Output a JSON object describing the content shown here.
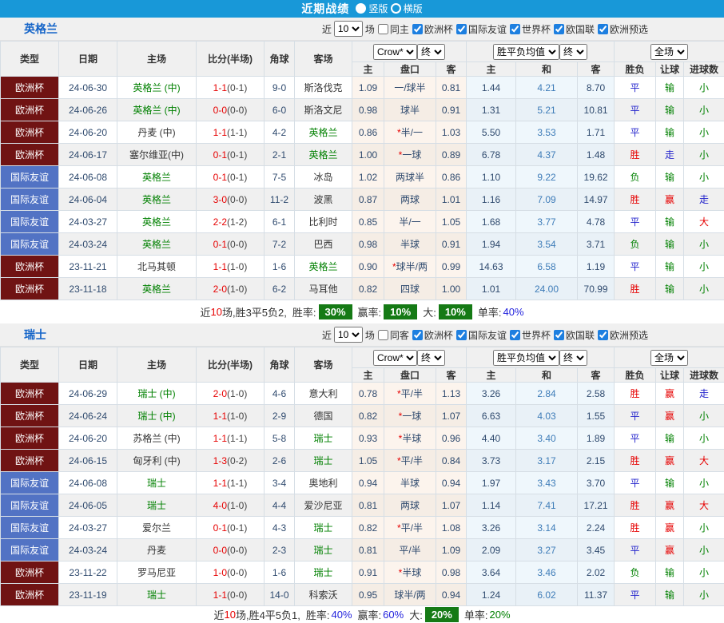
{
  "title_bar": {
    "title": "近期战绩",
    "layout_options": [
      {
        "label": "竖版",
        "selected": true
      },
      {
        "label": "横版",
        "selected": false
      }
    ]
  },
  "colors": {
    "titlebar_bg": "#1898d8",
    "team_link_green": "#008000",
    "section_title_blue": "#1464c8",
    "score_red": "#e60000",
    "badge_green_bg": "#157a15",
    "type_colors": {
      "欧洲杯": "#701313",
      "国际友谊": "#5273c4"
    },
    "result_colors": {
      "胜": "#e60000",
      "平": "#2323cc",
      "负": "#008000",
      "赢": "#e60000",
      "输": "#008000",
      "走": "#2323cc",
      "大": "#e60000",
      "小": "#008000"
    }
  },
  "table_header": {
    "type": "类型",
    "date": "日期",
    "home": "主场",
    "score": "比分(半场)",
    "corner": "角球",
    "away": "客场",
    "odds_company_select": "Crow*",
    "odds_final_select": "终",
    "odds_cols": [
      "主",
      "盘口",
      "客"
    ],
    "mean_select": "胜平负均值",
    "mean_final_select": "终",
    "mean_cols": [
      "主",
      "和",
      "客"
    ],
    "scope_select": "全场",
    "result_cols": [
      "胜负",
      "让球",
      "进球数"
    ]
  },
  "sections": [
    {
      "team": "英格兰",
      "filter": {
        "near_label": "近",
        "count_value": "10",
        "games_label": "场",
        "same_label": "同主",
        "same_checked": false,
        "leagues": [
          {
            "label": "欧洲杯",
            "checked": true
          },
          {
            "label": "国际友谊",
            "checked": true
          },
          {
            "label": "世界杯",
            "checked": true
          },
          {
            "label": "欧国联",
            "checked": true
          },
          {
            "label": "欧洲预选",
            "checked": true
          }
        ]
      },
      "rows": [
        {
          "type": "欧洲杯",
          "date": "24-06-30",
          "home": "英格兰 (中)",
          "home_is_team": true,
          "score": "1-1",
          "half": "(0-1)",
          "corner": "9-0",
          "away": "斯洛伐克",
          "away_is_team": false,
          "crow_home": "1.09",
          "handicap": "一/球半",
          "crow_away": "0.81",
          "mean_home": "1.44",
          "mean_draw": "4.21",
          "mean_away": "8.70",
          "result": "平",
          "handicap_result": "输",
          "goals_result": "小"
        },
        {
          "type": "欧洲杯",
          "date": "24-06-26",
          "home": "英格兰 (中)",
          "home_is_team": true,
          "score": "0-0",
          "half": "(0-0)",
          "corner": "6-0",
          "away": "斯洛文尼",
          "away_is_team": false,
          "crow_home": "0.98",
          "handicap": "球半",
          "crow_away": "0.91",
          "mean_home": "1.31",
          "mean_draw": "5.21",
          "mean_away": "10.81",
          "result": "平",
          "handicap_result": "输",
          "goals_result": "小"
        },
        {
          "type": "欧洲杯",
          "date": "24-06-20",
          "home": "丹麦 (中)",
          "home_is_team": false,
          "score": "1-1",
          "half": "(1-1)",
          "corner": "4-2",
          "away": "英格兰",
          "away_is_team": true,
          "crow_home": "0.86",
          "handicap": "*半/一",
          "crow_away": "1.03",
          "mean_home": "5.50",
          "mean_draw": "3.53",
          "mean_away": "1.71",
          "result": "平",
          "handicap_result": "输",
          "goals_result": "小"
        },
        {
          "type": "欧洲杯",
          "date": "24-06-17",
          "home": "塞尔维亚(中)",
          "home_is_team": false,
          "score": "0-1",
          "half": "(0-1)",
          "corner": "2-1",
          "away": "英格兰",
          "away_is_team": true,
          "crow_home": "1.00",
          "handicap": "*一球",
          "crow_away": "0.89",
          "mean_home": "6.78",
          "mean_draw": "4.37",
          "mean_away": "1.48",
          "result": "胜",
          "handicap_result": "走",
          "goals_result": "小"
        },
        {
          "type": "国际友谊",
          "date": "24-06-08",
          "home": "英格兰",
          "home_is_team": true,
          "score": "0-1",
          "half": "(0-1)",
          "corner": "7-5",
          "away": "冰岛",
          "away_is_team": false,
          "crow_home": "1.02",
          "handicap": "两球半",
          "crow_away": "0.86",
          "mean_home": "1.10",
          "mean_draw": "9.22",
          "mean_away": "19.62",
          "result": "负",
          "handicap_result": "输",
          "goals_result": "小"
        },
        {
          "type": "国际友谊",
          "date": "24-06-04",
          "home": "英格兰",
          "home_is_team": true,
          "score": "3-0",
          "half": "(0-0)",
          "corner": "11-2",
          "away": "波黑",
          "away_is_team": false,
          "crow_home": "0.87",
          "handicap": "两球",
          "crow_away": "1.01",
          "mean_home": "1.16",
          "mean_draw": "7.09",
          "mean_away": "14.97",
          "result": "胜",
          "handicap_result": "赢",
          "goals_result": "走"
        },
        {
          "type": "国际友谊",
          "date": "24-03-27",
          "home": "英格兰",
          "home_is_team": true,
          "score": "2-2",
          "half": "(1-2)",
          "corner": "6-1",
          "away": "比利时",
          "away_is_team": false,
          "crow_home": "0.85",
          "handicap": "半/一",
          "crow_away": "1.05",
          "mean_home": "1.68",
          "mean_draw": "3.77",
          "mean_away": "4.78",
          "result": "平",
          "handicap_result": "输",
          "goals_result": "大"
        },
        {
          "type": "国际友谊",
          "date": "24-03-24",
          "home": "英格兰",
          "home_is_team": true,
          "score": "0-1",
          "half": "(0-0)",
          "corner": "7-2",
          "away": "巴西",
          "away_is_team": false,
          "crow_home": "0.98",
          "handicap": "半球",
          "crow_away": "0.91",
          "mean_home": "1.94",
          "mean_draw": "3.54",
          "mean_away": "3.71",
          "result": "负",
          "handicap_result": "输",
          "goals_result": "小"
        },
        {
          "type": "欧洲杯",
          "date": "23-11-21",
          "home": "北马其顿",
          "home_is_team": false,
          "score": "1-1",
          "half": "(1-0)",
          "corner": "1-6",
          "away": "英格兰",
          "away_is_team": true,
          "crow_home": "0.90",
          "handicap": "*球半/两",
          "crow_away": "0.99",
          "mean_home": "14.63",
          "mean_draw": "6.58",
          "mean_away": "1.19",
          "result": "平",
          "handicap_result": "输",
          "goals_result": "小"
        },
        {
          "type": "欧洲杯",
          "date": "23-11-18",
          "home": "英格兰",
          "home_is_team": true,
          "score": "2-0",
          "half": "(1-0)",
          "corner": "6-2",
          "away": "马耳他",
          "away_is_team": false,
          "crow_home": "0.82",
          "handicap": "四球",
          "crow_away": "1.00",
          "mean_home": "1.01",
          "mean_draw": "24.00",
          "mean_away": "70.99",
          "result": "胜",
          "handicap_result": "输",
          "goals_result": "小"
        }
      ],
      "summary": {
        "near_label": "近",
        "count": "10",
        "record_text": "场,胜3平5负2,",
        "stats": [
          {
            "label": "胜率:",
            "value": "30%",
            "style": "badge"
          },
          {
            "label": "赢率:",
            "value": "10%",
            "style": "badge"
          },
          {
            "label": "大:",
            "value": "10%",
            "style": "badge"
          },
          {
            "label": "单率:",
            "value": "40%",
            "style": "blue"
          }
        ]
      }
    },
    {
      "team": "瑞士",
      "filter": {
        "near_label": "近",
        "count_value": "10",
        "games_label": "场",
        "same_label": "同客",
        "same_checked": false,
        "leagues": [
          {
            "label": "欧洲杯",
            "checked": true
          },
          {
            "label": "国际友谊",
            "checked": true
          },
          {
            "label": "世界杯",
            "checked": true
          },
          {
            "label": "欧国联",
            "checked": true
          },
          {
            "label": "欧洲预选",
            "checked": true
          }
        ]
      },
      "rows": [
        {
          "type": "欧洲杯",
          "date": "24-06-29",
          "home": "瑞士 (中)",
          "home_is_team": true,
          "score": "2-0",
          "half": "(1-0)",
          "corner": "4-6",
          "away": "意大利",
          "away_is_team": false,
          "crow_home": "0.78",
          "handicap": "*平/半",
          "crow_away": "1.13",
          "mean_home": "3.26",
          "mean_draw": "2.84",
          "mean_away": "2.58",
          "result": "胜",
          "handicap_result": "赢",
          "goals_result": "走"
        },
        {
          "type": "欧洲杯",
          "date": "24-06-24",
          "home": "瑞士 (中)",
          "home_is_team": true,
          "score": "1-1",
          "half": "(1-0)",
          "corner": "2-9",
          "away": "德国",
          "away_is_team": false,
          "crow_home": "0.82",
          "handicap": "*一球",
          "crow_away": "1.07",
          "mean_home": "6.63",
          "mean_draw": "4.03",
          "mean_away": "1.55",
          "result": "平",
          "handicap_result": "赢",
          "goals_result": "小"
        },
        {
          "type": "欧洲杯",
          "date": "24-06-20",
          "home": "苏格兰 (中)",
          "home_is_team": false,
          "score": "1-1",
          "half": "(1-1)",
          "corner": "5-8",
          "away": "瑞士",
          "away_is_team": true,
          "crow_home": "0.93",
          "handicap": "*半球",
          "crow_away": "0.96",
          "mean_home": "4.40",
          "mean_draw": "3.40",
          "mean_away": "1.89",
          "result": "平",
          "handicap_result": "输",
          "goals_result": "小"
        },
        {
          "type": "欧洲杯",
          "date": "24-06-15",
          "home": "匈牙利 (中)",
          "home_is_team": false,
          "score": "1-3",
          "half": "(0-2)",
          "corner": "2-6",
          "away": "瑞士",
          "away_is_team": true,
          "crow_home": "1.05",
          "handicap": "*平/半",
          "crow_away": "0.84",
          "mean_home": "3.73",
          "mean_draw": "3.17",
          "mean_away": "2.15",
          "result": "胜",
          "handicap_result": "赢",
          "goals_result": "大"
        },
        {
          "type": "国际友谊",
          "date": "24-06-08",
          "home": "瑞士",
          "home_is_team": true,
          "score": "1-1",
          "half": "(1-1)",
          "corner": "3-4",
          "away": "奥地利",
          "away_is_team": false,
          "crow_home": "0.94",
          "handicap": "半球",
          "crow_away": "0.94",
          "mean_home": "1.97",
          "mean_draw": "3.43",
          "mean_away": "3.70",
          "result": "平",
          "handicap_result": "输",
          "goals_result": "小"
        },
        {
          "type": "国际友谊",
          "date": "24-06-05",
          "home": "瑞士",
          "home_is_team": true,
          "score": "4-0",
          "half": "(1-0)",
          "corner": "4-4",
          "away": "爱沙尼亚",
          "away_is_team": false,
          "crow_home": "0.81",
          "handicap": "两球",
          "crow_away": "1.07",
          "mean_home": "1.14",
          "mean_draw": "7.41",
          "mean_away": "17.21",
          "result": "胜",
          "handicap_result": "赢",
          "goals_result": "大"
        },
        {
          "type": "国际友谊",
          "date": "24-03-27",
          "home": "爱尔兰",
          "home_is_team": false,
          "score": "0-1",
          "half": "(0-1)",
          "corner": "4-3",
          "away": "瑞士",
          "away_is_team": true,
          "crow_home": "0.82",
          "handicap": "*平/半",
          "crow_away": "1.08",
          "mean_home": "3.26",
          "mean_draw": "3.14",
          "mean_away": "2.24",
          "result": "胜",
          "handicap_result": "赢",
          "goals_result": "小"
        },
        {
          "type": "国际友谊",
          "date": "24-03-24",
          "home": "丹麦",
          "home_is_team": false,
          "score": "0-0",
          "half": "(0-0)",
          "corner": "2-3",
          "away": "瑞士",
          "away_is_team": true,
          "crow_home": "0.81",
          "handicap": "平/半",
          "crow_away": "1.09",
          "mean_home": "2.09",
          "mean_draw": "3.27",
          "mean_away": "3.45",
          "result": "平",
          "handicap_result": "赢",
          "goals_result": "小"
        },
        {
          "type": "欧洲杯",
          "date": "23-11-22",
          "home": "罗马尼亚",
          "home_is_team": false,
          "score": "1-0",
          "half": "(0-0)",
          "corner": "1-6",
          "away": "瑞士",
          "away_is_team": true,
          "crow_home": "0.91",
          "handicap": "*半球",
          "crow_away": "0.98",
          "mean_home": "3.64",
          "mean_draw": "3.46",
          "mean_away": "2.02",
          "result": "负",
          "handicap_result": "输",
          "goals_result": "小"
        },
        {
          "type": "欧洲杯",
          "date": "23-11-19",
          "home": "瑞士",
          "home_is_team": true,
          "score": "1-1",
          "half": "(0-0)",
          "corner": "14-0",
          "away": "科索沃",
          "away_is_team": false,
          "crow_home": "0.95",
          "handicap": "球半/两",
          "crow_away": "0.94",
          "mean_home": "1.24",
          "mean_draw": "6.02",
          "mean_away": "11.37",
          "result": "平",
          "handicap_result": "输",
          "goals_result": "小"
        }
      ],
      "summary": {
        "near_label": "近",
        "count": "10",
        "record_text": "场,胜4平5负1,",
        "stats": [
          {
            "label": "胜率:",
            "value": "40%",
            "style": "blue"
          },
          {
            "label": "赢率:",
            "value": "60%",
            "style": "blue"
          },
          {
            "label": "大:",
            "value": "20%",
            "style": "badge"
          },
          {
            "label": "单率:",
            "value": "20%",
            "style": "green"
          }
        ]
      }
    }
  ]
}
